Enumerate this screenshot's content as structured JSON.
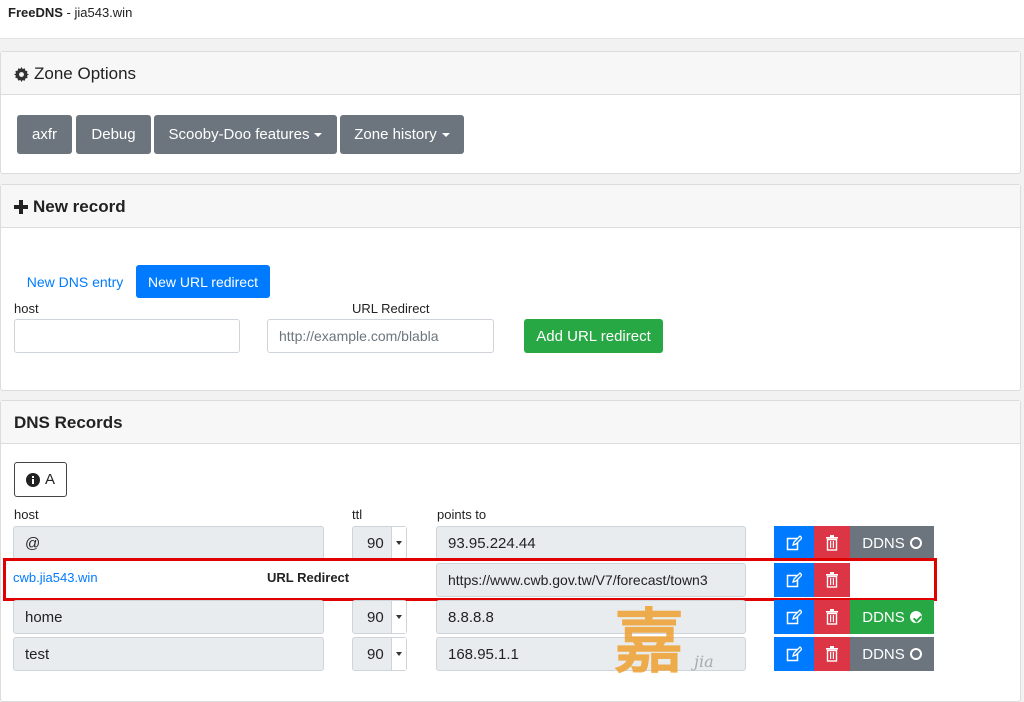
{
  "app": {
    "brand": "FreeDNS",
    "separator": " - ",
    "domain": "jia543.win"
  },
  "zone_options": {
    "title": "Zone Options",
    "buttons": {
      "axfr": "axfr",
      "debug": "Debug",
      "scooby": "Scooby-Doo features",
      "history": "Zone history"
    }
  },
  "new_record": {
    "title": "New record",
    "tab_dns": "New DNS entry",
    "tab_url": "New URL redirect",
    "host_label": "host",
    "host_value": "",
    "url_label": "URL Redirect",
    "url_placeholder": "http://example.com/blabla",
    "add_button": "Add URL redirect"
  },
  "dns_records": {
    "title": "DNS Records",
    "type_filter": "A",
    "col_host": "host",
    "col_ttl": "ttl",
    "col_points": "points to",
    "rows": [
      {
        "host": "@",
        "ttl": "90",
        "points_to": "93.95.224.44",
        "ddns": "DDNS",
        "ddns_on": false
      },
      {
        "host": "cwb.jia543.win",
        "type": "URL Redirect",
        "points_to": "https://www.cwb.gov.tw/V7/forecast/town3"
      },
      {
        "host": "home",
        "ttl": "90",
        "points_to": "8.8.8.8",
        "ddns": "DDNS",
        "ddns_on": true
      },
      {
        "host": "test",
        "ttl": "90",
        "points_to": "168.95.1.1",
        "ddns": "DDNS",
        "ddns_on": false
      }
    ]
  },
  "watermark": {
    "char": "嘉",
    "latin": "jia"
  },
  "colors": {
    "primary": "#007bff",
    "secondary": "#6c757d",
    "success": "#28a745",
    "danger": "#dc3545",
    "highlight": "#e00000"
  }
}
